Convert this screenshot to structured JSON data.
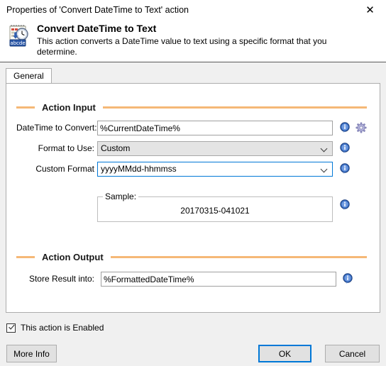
{
  "window": {
    "title": "Properties of 'Convert DateTime to Text' action",
    "close_label": "✕",
    "close_icon": "close-icon"
  },
  "header": {
    "icon": "calendar-clock-abcde-icon",
    "icon_caption": "abcde",
    "title": "Convert DateTime to Text",
    "description": "This action converts a DateTime value to text using a specific format that you determine."
  },
  "tabs": [
    {
      "label": "General",
      "active": true
    }
  ],
  "sections": {
    "action_input": {
      "label": "Action Input",
      "fields": {
        "datetime_to_convert": {
          "label": "DateTime to Convert:",
          "value": "%CurrentDateTime%",
          "placeholder": "",
          "info_icon": "info-icon",
          "gear_icon": "gear-icon"
        },
        "format_to_use": {
          "label": "Format to Use:",
          "value": "Custom",
          "options": [
            "Custom"
          ],
          "info_icon": "info-icon"
        },
        "custom_format": {
          "label": "Custom Format",
          "value": "yyyyMMdd-hhmmss",
          "options": [
            "yyyyMMdd-hhmmss"
          ],
          "info_icon": "info-icon"
        },
        "sample": {
          "label": "Sample:",
          "value": "20170315-041021",
          "info_icon": "info-icon"
        }
      }
    },
    "action_output": {
      "label": "Action Output",
      "fields": {
        "store_result_into": {
          "label": "Store Result into:",
          "value": "%FormattedDateTime%",
          "placeholder": "",
          "info_icon": "info-icon"
        }
      }
    }
  },
  "footer": {
    "enabled_checkbox": {
      "label": "This action is Enabled",
      "checked": true
    },
    "more_info_button": "More Info",
    "ok_button": "OK",
    "cancel_button": "Cancel"
  },
  "colors": {
    "accent_orange": "#f5b877",
    "focus_blue": "#0078d7",
    "dialog_bg": "#f0f0f0",
    "panel_bg": "#ffffff",
    "info_icon_blue": "#2b5fb8",
    "gear_icon_purple": "#8f8fc0"
  }
}
